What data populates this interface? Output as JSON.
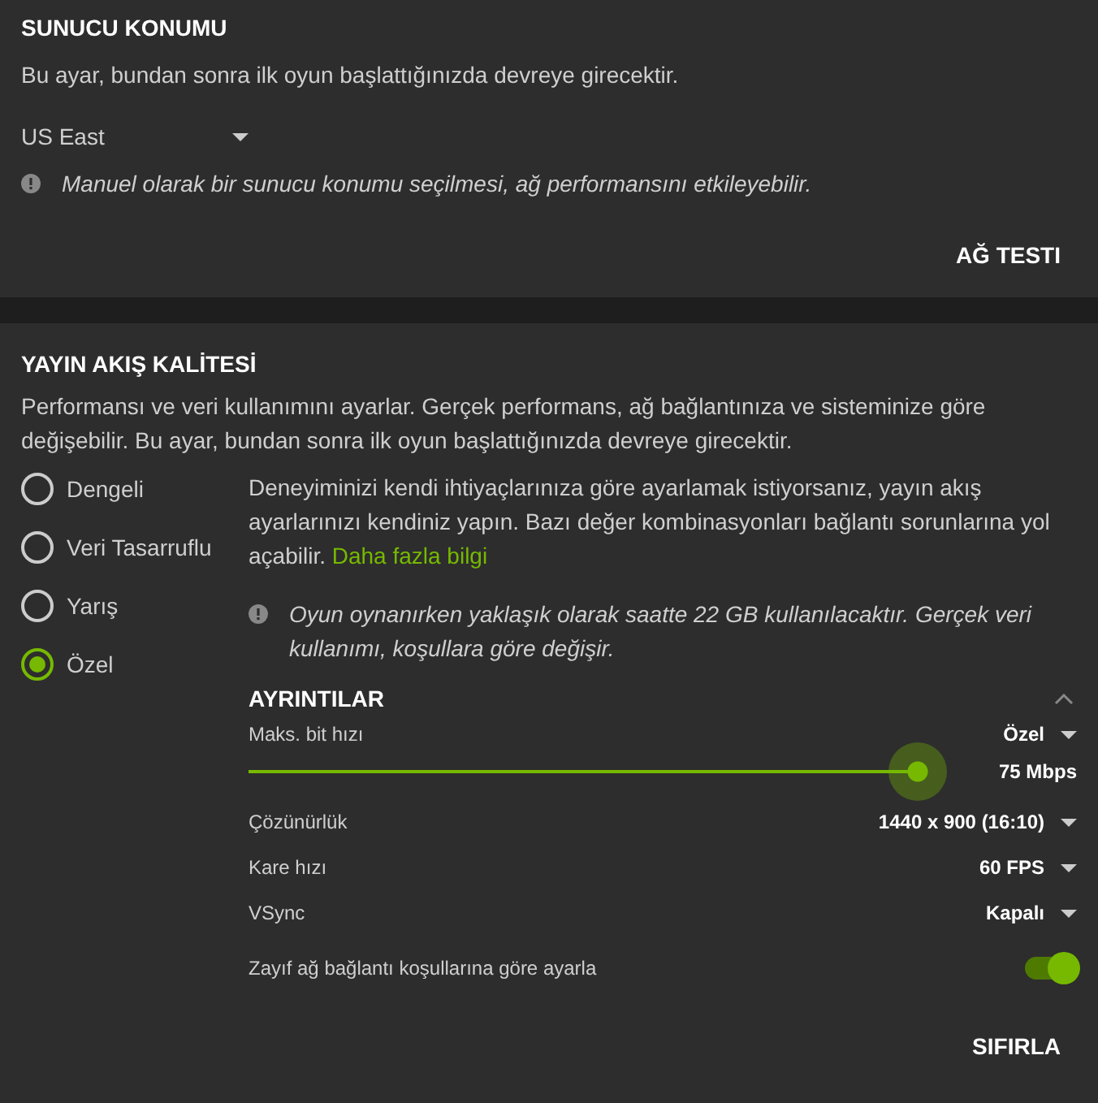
{
  "server_location": {
    "title": "SUNUCU KONUMU",
    "description": "Bu ayar, bundan sonra ilk oyun başlattığınızda devreye girecektir.",
    "dropdown": {
      "value": "US East"
    },
    "note": "Manuel olarak bir sunucu konumu seçilmesi, ağ performansını etkileyebilir.",
    "button": "AĞ TESTI"
  },
  "streaming_quality": {
    "title": "YAYIN AKIŞ KALİTESİ",
    "description": "Performansı ve veri kullanımını ayarlar. Gerçek performans, ağ bağlantınıza ve sisteminize göre değişebilir. Bu ayar, bundan sonra ilk oyun başlattığınızda devreye girecektir.",
    "presets": [
      {
        "label": "Dengeli",
        "selected": false
      },
      {
        "label": "Veri Tasarruflu",
        "selected": false
      },
      {
        "label": "Yarış",
        "selected": false
      },
      {
        "label": "Özel",
        "selected": true
      }
    ],
    "custom_description": {
      "text": "Deneyiminizi kendi ihtiyaçlarınıza göre ayarlamak istiyorsanız, yayın akış ayarlarınızı kendiniz yapın. Bazı değer kombinasyonları bağlantı sorunlarına yol açabilir.",
      "link": "Daha fazla bilgi"
    },
    "note": "Oyun oynanırken yaklaşık olarak saatte 22 GB kullanılacaktır. Gerçek veri kullanımı, koşullara göre değişir.",
    "details": {
      "title": "AYRINTILAR",
      "expanded": true,
      "bitrate": {
        "label": "Maks. bit hızı",
        "value": "Özel",
        "level": 1,
        "reading": "75 Mbps"
      },
      "settings": [
        {
          "label": "Çözünürlük",
          "value": "1440 x 900 (16:10)"
        },
        {
          "label": "Kare hızı",
          "value": "60 FPS"
        },
        {
          "label": "VSync",
          "value": "Kapalı"
        }
      ],
      "toggle": {
        "label": "Zayıf ağ bağlantı koşullarına göre ayarla",
        "on": true
      }
    },
    "reset_button": "SIFIRLA"
  }
}
